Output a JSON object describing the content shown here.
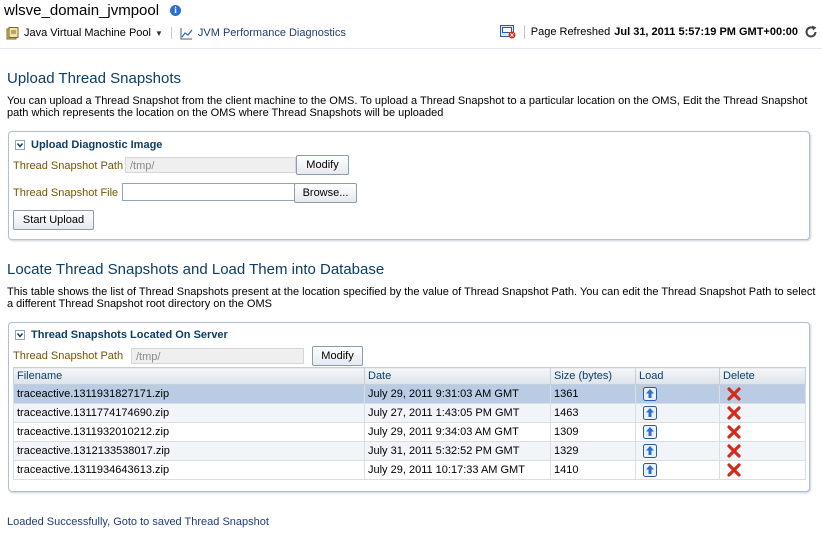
{
  "header": {
    "target_name": "wlsve_domain_jvmpool",
    "menu": [
      {
        "label": "Java Virtual Machine Pool"
      },
      {
        "label": "JVM Performance Diagnostics"
      }
    ],
    "refresh_label": "Page Refreshed",
    "refresh_time": "Jul 31, 2011 5:57:19 PM GMT+00:00"
  },
  "upload": {
    "title": "Upload Thread Snapshots",
    "description": "You can upload a Thread Snapshot from the client machine to the OMS. To upload a Thread Snapshot to a particular location on the OMS, Edit the Thread Snapshot path which represents the location on the OMS where Thread Snapshots will be uploaded",
    "box_title": "Upload Diagnostic Image",
    "path_label": "Thread Snapshot Path",
    "path_value": "/tmp/",
    "modify_label": "Modify",
    "file_label": "Thread Snapshot File",
    "file_value": "",
    "browse_label": "Browse...",
    "start_label": "Start Upload"
  },
  "locate": {
    "title": "Locate Thread Snapshots and Load Them into Database",
    "description": "This table shows the list of Thread Snapshots present at the location specified by the value of Thread Snapshot Path. You can edit the Thread Snapshot Path to select a different Thread Snapshot root directory on the OMS",
    "box_title": "Thread Snapshots Located On Server",
    "path_label": "Thread Snapshot Path",
    "path_value": "/tmp/",
    "modify_label": "Modify",
    "columns": [
      "Filename",
      "Date",
      "Size (bytes)",
      "Load",
      "Delete"
    ],
    "rows": [
      {
        "filename": "traceactive.1311931827171.zip",
        "date": "July 29, 2011 9:31:03 AM GMT",
        "size": "1361"
      },
      {
        "filename": "traceactive.1311774174690.zip",
        "date": "July 27, 2011 1:43:05 PM GMT",
        "size": "1463"
      },
      {
        "filename": "traceactive.1311932010212.zip",
        "date": "July 29, 2011 9:34:03 AM GMT",
        "size": "1309"
      },
      {
        "filename": "traceactive.1312133538017.zip",
        "date": "July 31, 2011 5:32:52 PM GMT",
        "size": "1329"
      },
      {
        "filename": "traceactive.1311934643613.zip",
        "date": "July 29, 2011 10:17:33 AM GMT",
        "size": "1410"
      }
    ]
  },
  "status_message": "Loaded Successfully, Goto to saved Thread Snapshot",
  "colors": {
    "title_blue": "#0c3d66",
    "label_brown": "#775500",
    "selected_row": "#b9cce3",
    "delete_red": "#d42a1a"
  }
}
